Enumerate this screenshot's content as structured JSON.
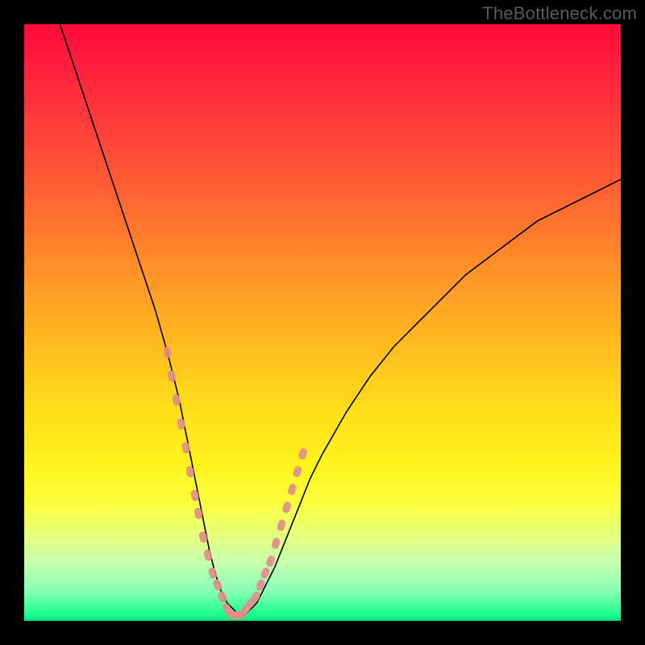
{
  "watermark": "TheBottleneck.com",
  "chart_data": {
    "type": "line",
    "title": "",
    "xlabel": "",
    "ylabel": "",
    "xlim": [
      0,
      100
    ],
    "ylim": [
      0,
      100
    ],
    "grid": false,
    "legend": false,
    "colors": {
      "gradient_top": "#ff0a3a",
      "gradient_mid": "#ffe21a",
      "gradient_bottom": "#00e57a",
      "curve": "#000000",
      "markers": "#e28d8a"
    },
    "series": [
      {
        "name": "bottleneck-curve",
        "kind": "line",
        "x": [
          6,
          8,
          10,
          12,
          14,
          16,
          18,
          20,
          22,
          24,
          26,
          27,
          28,
          29,
          30,
          31,
          32,
          33,
          34,
          35,
          36,
          37,
          38,
          39,
          40,
          42,
          44,
          46,
          48,
          50,
          54,
          58,
          62,
          66,
          70,
          74,
          78,
          82,
          86,
          90,
          94,
          98,
          100
        ],
        "y": [
          100,
          94,
          88,
          82,
          76,
          70,
          64,
          58,
          52,
          45,
          37,
          32,
          27,
          22,
          17,
          12,
          8,
          5,
          3,
          2,
          1,
          1,
          2,
          3,
          5,
          9,
          14,
          19,
          24,
          28,
          35,
          41,
          46,
          50,
          54,
          58,
          61,
          64,
          67,
          69,
          71,
          73,
          74
        ]
      },
      {
        "name": "curve-markers",
        "kind": "scatter",
        "x": [
          24.0,
          24.7,
          25.5,
          26.3,
          27.1,
          27.8,
          28.6,
          29.2,
          30.0,
          30.8,
          31.6,
          32.4,
          33.2,
          34.0,
          34.8,
          35.6,
          36.4,
          37.2,
          38.0,
          38.8,
          39.6,
          40.4,
          41.3,
          42.2,
          43.1,
          44.0,
          44.9,
          45.8,
          46.7
        ],
        "y": [
          45,
          41,
          37,
          33,
          29,
          25,
          21,
          18,
          14,
          11,
          8,
          6,
          4,
          2,
          1,
          1,
          1,
          2,
          3,
          4,
          6,
          8,
          10,
          13,
          16,
          19,
          22,
          25,
          28
        ]
      }
    ],
    "annotations": []
  }
}
